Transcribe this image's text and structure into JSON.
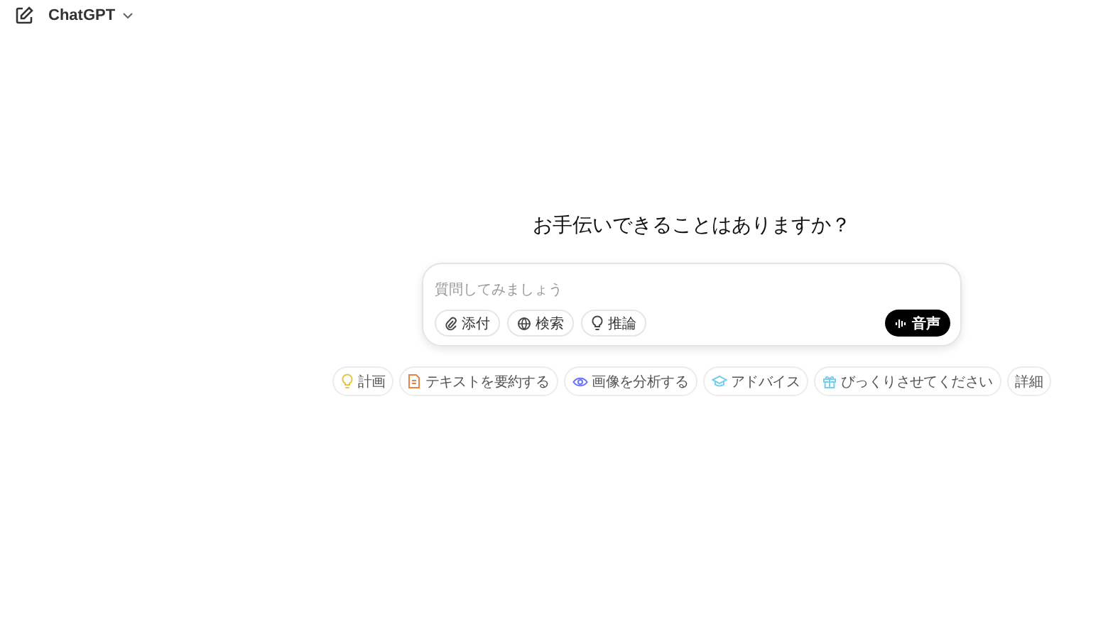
{
  "header": {
    "title": "ChatGPT"
  },
  "heading": "お手伝いできることはありますか？",
  "composer": {
    "placeholder": "質問してみましょう",
    "tools": [
      {
        "label": "添付",
        "kind": "clip"
      },
      {
        "label": "検索",
        "kind": "globe"
      },
      {
        "label": "推論",
        "kind": "bulb"
      }
    ],
    "voice_button": "音声"
  },
  "suggestions": [
    {
      "label": "計画",
      "kind": "bulb",
      "color": "#e2c541"
    },
    {
      "label": "テキストを要約する",
      "kind": "doc",
      "color": "#ea8444"
    },
    {
      "label": "画像を分析する",
      "kind": "eye",
      "color": "#6c71ff"
    },
    {
      "label": "アドバイス",
      "kind": "cap",
      "color": "#76d0eb"
    },
    {
      "label": "びっくりさせてください",
      "kind": "gift",
      "color": "#76d0eb"
    },
    {
      "label": "詳細",
      "kind": "text"
    }
  ]
}
